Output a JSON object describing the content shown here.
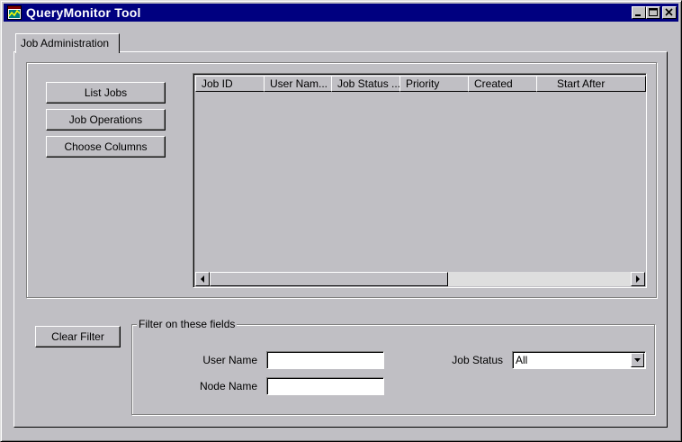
{
  "window": {
    "title": "QueryMonitor Tool",
    "title_bar_color": "#000080",
    "icons": [
      "app-icon",
      "minimize-icon",
      "maximize-icon",
      "close-icon"
    ]
  },
  "tabs": [
    {
      "label": "Job Administration",
      "selected": true
    }
  ],
  "actions": {
    "list_jobs": "List Jobs",
    "job_operations": "Job Operations",
    "choose_columns": "Choose Columns",
    "clear_filter": "Clear Filter"
  },
  "jobs_table": {
    "columns": [
      "Job ID",
      "User Nam...",
      "Job Status ...",
      "Priority",
      "Created",
      "Start After"
    ],
    "rows": []
  },
  "filter": {
    "legend": "Filter on these fields",
    "user_name_label": "User Name",
    "user_name_value": "",
    "node_name_label": "Node Name",
    "node_name_value": "",
    "job_status_label": "Job Status",
    "job_status_value": "All"
  }
}
